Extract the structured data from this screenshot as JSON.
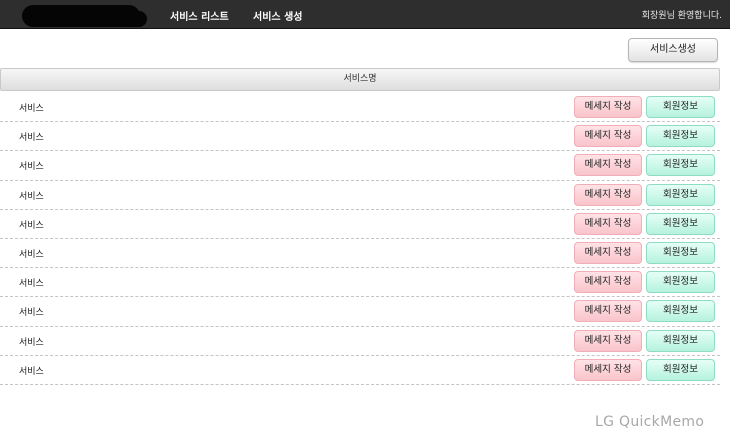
{
  "header": {
    "nav": [
      {
        "label": "서비스 리스트"
      },
      {
        "label": "서비스 생성"
      }
    ],
    "welcome": "회장원님 환영합니다."
  },
  "toolbar": {
    "create_label": "서비스생성"
  },
  "table": {
    "column_header": "서비스명",
    "rows": [
      {
        "name": "서비스",
        "message_label": "메세지 작성",
        "member_label": "회원정보"
      },
      {
        "name": "서비스",
        "message_label": "메세지 작성",
        "member_label": "회원정보"
      },
      {
        "name": "서비스",
        "message_label": "메세지 작성",
        "member_label": "회원정보"
      },
      {
        "name": "서비스",
        "message_label": "메세지 작성",
        "member_label": "회원정보"
      },
      {
        "name": "서비스",
        "message_label": "메세지 작성",
        "member_label": "회원정보"
      },
      {
        "name": "서비스",
        "message_label": "메세지 작성",
        "member_label": "회원정보"
      },
      {
        "name": "서비스",
        "message_label": "메세지 작성",
        "member_label": "회원정보"
      },
      {
        "name": "서비스",
        "message_label": "메세지 작성",
        "member_label": "회원정보"
      },
      {
        "name": "서비스",
        "message_label": "메세지 작성",
        "member_label": "회원정보"
      },
      {
        "name": "서비스",
        "message_label": "메세지 작성",
        "member_label": "회원정보"
      }
    ]
  },
  "watermark": "LG QuickMemo",
  "colors": {
    "topbar": "#2e2e2e",
    "message_button": "#f9c4cb",
    "member_button": "#b5f2dd"
  }
}
